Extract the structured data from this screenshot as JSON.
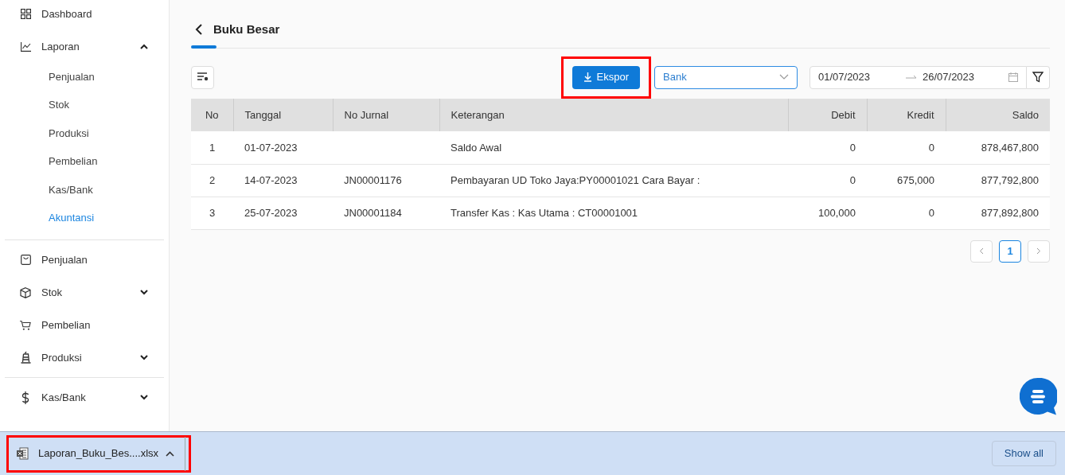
{
  "sidebar": {
    "sections": [
      [
        {
          "label": "Dashboard",
          "kind": "link"
        },
        {
          "label": "Laporan",
          "kind": "group",
          "expanded": true,
          "children": [
            {
              "label": "Penjualan",
              "selected": false
            },
            {
              "label": "Stok",
              "selected": false
            },
            {
              "label": "Produksi",
              "selected": false
            },
            {
              "label": "Pembelian",
              "selected": false
            },
            {
              "label": "Kas/Bank",
              "selected": false
            },
            {
              "label": "Akuntansi",
              "selected": true
            }
          ]
        }
      ],
      [
        {
          "label": "Penjualan",
          "kind": "link"
        },
        {
          "label": "Stok",
          "kind": "group",
          "expanded": false
        },
        {
          "label": "Pembelian",
          "kind": "link"
        },
        {
          "label": "Produksi",
          "kind": "group",
          "expanded": false
        }
      ],
      [
        {
          "label": "Kas/Bank",
          "kind": "group",
          "expanded": false
        }
      ]
    ]
  },
  "page": {
    "title": "Buku Besar"
  },
  "toolbar": {
    "export_button": {
      "label": "Ekspor",
      "highlighted": true
    },
    "account_select": {
      "value": "Bank"
    },
    "date_range": {
      "start": "01/07/2023",
      "end": "26/07/2023"
    }
  },
  "table": {
    "columns": [
      "No",
      "Tanggal",
      "No Jurnal",
      "Keterangan",
      "Debit",
      "Kredit",
      "Saldo"
    ],
    "rows": [
      [
        "1",
        "01-07-2023",
        "",
        "Saldo Awal",
        "0",
        "0",
        "878,467,800"
      ],
      [
        "2",
        "14-07-2023",
        "JN00001176",
        "Pembayaran UD Toko Jaya:PY00001021 Cara Bayar :",
        "0",
        "675,000",
        "877,792,800"
      ],
      [
        "3",
        "25-07-2023",
        "JN00001184",
        "Transfer Kas : Kas Utama : CT00001001",
        "100,000",
        "0",
        "877,892,800"
      ]
    ]
  },
  "pagination": {
    "pages": [
      {
        "label": "1",
        "selected": true
      }
    ]
  },
  "download_bar": {
    "file": {
      "name": "Laporan_Buku_Bes....xlsx",
      "highlighted": true
    },
    "show_all": "Show all"
  }
}
